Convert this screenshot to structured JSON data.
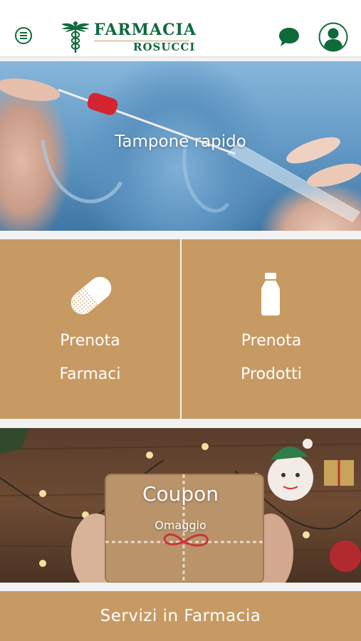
{
  "header": {
    "logo": {
      "title": "FARMACIA",
      "subtitle": "ROSUCCI"
    },
    "icons": {
      "menu": "menu-icon",
      "chat": "chat-bubble-icon",
      "user": "user-profile-icon"
    },
    "brand_color": "#0f6a3a"
  },
  "banners": {
    "tampone": {
      "title": "Tampone rapido"
    },
    "coupon": {
      "title": "Coupon",
      "subtitle": "Omaggio"
    }
  },
  "tiles": [
    {
      "line1": "Prenota",
      "line2": "Farmaci",
      "icon": "pill-capsule-icon"
    },
    {
      "line1": "Prenota",
      "line2": "Prodotti",
      "icon": "bottle-icon"
    }
  ],
  "services": {
    "label": "Servizi in Farmacia"
  },
  "colors": {
    "tile": "#c79a64",
    "background": "#f2f2f2"
  }
}
